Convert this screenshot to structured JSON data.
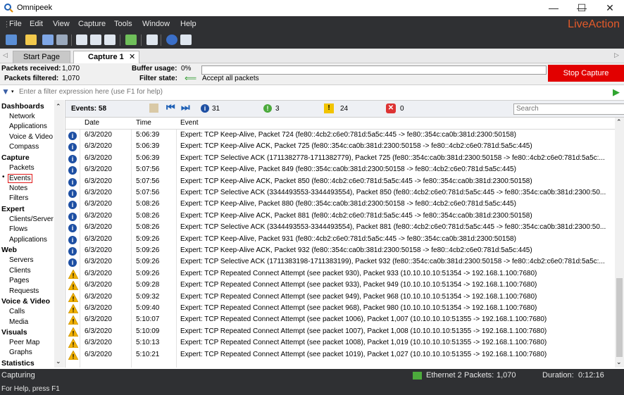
{
  "window": {
    "app_title": "Omnipeek",
    "minimize": "—",
    "maximize": "☐",
    "close": "✕"
  },
  "menu": {
    "items": [
      "File",
      "Edit",
      "View",
      "Capture",
      "Tools",
      "Window",
      "Help"
    ],
    "brand": "LiveAction"
  },
  "tabs": [
    {
      "label": "Start Page"
    },
    {
      "label": "Capture 1"
    }
  ],
  "stats": {
    "packets_received_label": "Packets received:",
    "packets_received": "1,070",
    "packets_filtered_label": "Packets filtered:",
    "packets_filtered": "1,070",
    "buffer_usage_label": "Buffer usage:",
    "buffer_usage": "0%",
    "filter_state_label": "Filter state:",
    "filter_state": "Accept all packets",
    "stop_capture": "Stop Capture"
  },
  "filter": {
    "placeholder": "Enter a filter expression here (use F1 for help)"
  },
  "nav": [
    {
      "type": "h",
      "label": "Dashboards"
    },
    {
      "type": "i",
      "label": "Network"
    },
    {
      "type": "i",
      "label": "Applications"
    },
    {
      "type": "i",
      "label": "Voice & Video"
    },
    {
      "type": "i",
      "label": "Compass"
    },
    {
      "type": "h",
      "label": "Capture"
    },
    {
      "type": "i",
      "label": "Packets"
    },
    {
      "type": "i",
      "label": "Events",
      "selected": true
    },
    {
      "type": "i",
      "label": "Notes"
    },
    {
      "type": "i",
      "label": "Filters"
    },
    {
      "type": "h",
      "label": "Expert"
    },
    {
      "type": "i",
      "label": "Clients/Server"
    },
    {
      "type": "i",
      "label": "Flows"
    },
    {
      "type": "i",
      "label": "Applications"
    },
    {
      "type": "h",
      "label": "Web"
    },
    {
      "type": "i",
      "label": "Servers"
    },
    {
      "type": "i",
      "label": "Clients"
    },
    {
      "type": "i",
      "label": "Pages"
    },
    {
      "type": "i",
      "label": "Requests"
    },
    {
      "type": "h",
      "label": "Voice & Video"
    },
    {
      "type": "i",
      "label": "Calls"
    },
    {
      "type": "i",
      "label": "Media"
    },
    {
      "type": "h",
      "label": "Visuals"
    },
    {
      "type": "i",
      "label": "Peer Map"
    },
    {
      "type": "i",
      "label": "Graphs"
    },
    {
      "type": "h",
      "label": "Statistics"
    }
  ],
  "events_bar": {
    "events_label": "Events: 58",
    "info_count": "31",
    "minor_count": "3",
    "warn_count": "24",
    "error_count": "0",
    "search_placeholder": "Search"
  },
  "columns": [
    "Date",
    "Time",
    "Event"
  ],
  "rows": [
    {
      "sev": "info",
      "date": "6/3/2020",
      "time": "5:06:39",
      "event": "Expert: TCP Keep-Alive, Packet 724 (fe80::4cb2:c6e0:781d:5a5c:445 -> fe80::354c:ca0b:381d:2300:50158)"
    },
    {
      "sev": "info",
      "date": "6/3/2020",
      "time": "5:06:39",
      "event": "Expert: TCP Keep-Alive ACK, Packet 725 (fe80::354c:ca0b:381d:2300:50158 -> fe80::4cb2:c6e0:781d:5a5c:445)"
    },
    {
      "sev": "info",
      "date": "6/3/2020",
      "time": "5:06:39",
      "event": "Expert: TCP Selective ACK (1711382778-1711382779), Packet 725 (fe80::354c:ca0b:381d:2300:50158 -> fe80::4cb2:c6e0:781d:5a5c:..."
    },
    {
      "sev": "info",
      "date": "6/3/2020",
      "time": "5:07:56",
      "event": "Expert: TCP Keep-Alive, Packet 849 (fe80::354c:ca0b:381d:2300:50158 -> fe80::4cb2:c6e0:781d:5a5c:445)"
    },
    {
      "sev": "info",
      "date": "6/3/2020",
      "time": "5:07:56",
      "event": "Expert: TCP Keep-Alive ACK, Packet 850 (fe80::4cb2:c6e0:781d:5a5c:445 -> fe80::354c:ca0b:381d:2300:50158)"
    },
    {
      "sev": "info",
      "date": "6/3/2020",
      "time": "5:07:56",
      "event": "Expert: TCP Selective ACK (3344493553-3344493554), Packet 850 (fe80::4cb2:c6e0:781d:5a5c:445 -> fe80::354c:ca0b:381d:2300:50..."
    },
    {
      "sev": "info",
      "date": "6/3/2020",
      "time": "5:08:26",
      "event": "Expert: TCP Keep-Alive, Packet 880 (fe80::354c:ca0b:381d:2300:50158 -> fe80::4cb2:c6e0:781d:5a5c:445)"
    },
    {
      "sev": "info",
      "date": "6/3/2020",
      "time": "5:08:26",
      "event": "Expert: TCP Keep-Alive ACK, Packet 881 (fe80::4cb2:c6e0:781d:5a5c:445 -> fe80::354c:ca0b:381d:2300:50158)"
    },
    {
      "sev": "info",
      "date": "6/3/2020",
      "time": "5:08:26",
      "event": "Expert: TCP Selective ACK (3344493553-3344493554), Packet 881 (fe80::4cb2:c6e0:781d:5a5c:445 -> fe80::354c:ca0b:381d:2300:50..."
    },
    {
      "sev": "info",
      "date": "6/3/2020",
      "time": "5:09:26",
      "event": "Expert: TCP Keep-Alive, Packet 931 (fe80::4cb2:c6e0:781d:5a5c:445 -> fe80::354c:ca0b:381d:2300:50158)"
    },
    {
      "sev": "info",
      "date": "6/3/2020",
      "time": "5:09:26",
      "event": "Expert: TCP Keep-Alive ACK, Packet 932 (fe80::354c:ca0b:381d:2300:50158 -> fe80::4cb2:c6e0:781d:5a5c:445)"
    },
    {
      "sev": "info",
      "date": "6/3/2020",
      "time": "5:09:26",
      "event": "Expert: TCP Selective ACK (1711383198-1711383199), Packet 932 (fe80::354c:ca0b:381d:2300:50158 -> fe80::4cb2:c6e0:781d:5a5c:..."
    },
    {
      "sev": "warn",
      "date": "6/3/2020",
      "time": "5:09:26",
      "event": "Expert: TCP Repeated Connect Attempt (see packet 930), Packet 933 (10.10.10.10:51354 -> 192.168.1.100:7680)"
    },
    {
      "sev": "warn",
      "date": "6/3/2020",
      "time": "5:09:28",
      "event": "Expert: TCP Repeated Connect Attempt (see packet 933), Packet 949 (10.10.10.10:51354 -> 192.168.1.100:7680)"
    },
    {
      "sev": "warn",
      "date": "6/3/2020",
      "time": "5:09:32",
      "event": "Expert: TCP Repeated Connect Attempt (see packet 949), Packet 968 (10.10.10.10:51354 -> 192.168.1.100:7680)"
    },
    {
      "sev": "warn",
      "date": "6/3/2020",
      "time": "5:09:40",
      "event": "Expert: TCP Repeated Connect Attempt (see packet 968), Packet 980 (10.10.10.10:51354 -> 192.168.1.100:7680)"
    },
    {
      "sev": "warn",
      "date": "6/3/2020",
      "time": "5:10:07",
      "event": "Expert: TCP Repeated Connect Attempt (see packet 1006), Packet 1,007 (10.10.10.10:51355 -> 192.168.1.100:7680)"
    },
    {
      "sev": "warn",
      "date": "6/3/2020",
      "time": "5:10:09",
      "event": "Expert: TCP Repeated Connect Attempt (see packet 1007), Packet 1,008 (10.10.10.10:51355 -> 192.168.1.100:7680)"
    },
    {
      "sev": "warn",
      "date": "6/3/2020",
      "time": "5:10:13",
      "event": "Expert: TCP Repeated Connect Attempt (see packet 1008), Packet 1,019 (10.10.10.10:51355 -> 192.168.1.100:7680)"
    },
    {
      "sev": "warn",
      "date": "6/3/2020",
      "time": "5:10:21",
      "event": "Expert: TCP Repeated Connect Attempt (see packet 1019), Packet 1,027 (10.10.10.10:51355 -> 192.168.1.100:7680)"
    }
  ],
  "status": {
    "capturing": "Capturing",
    "adapter": "Ethernet 2",
    "packets_label": "Packets:",
    "packets": "1,070",
    "duration_label": "Duration:",
    "duration": "0:12:16",
    "help": "For Help, press F1"
  },
  "colors": {
    "accent": "#e20000",
    "brand": "#e35a2a",
    "dark": "#2f3033"
  }
}
